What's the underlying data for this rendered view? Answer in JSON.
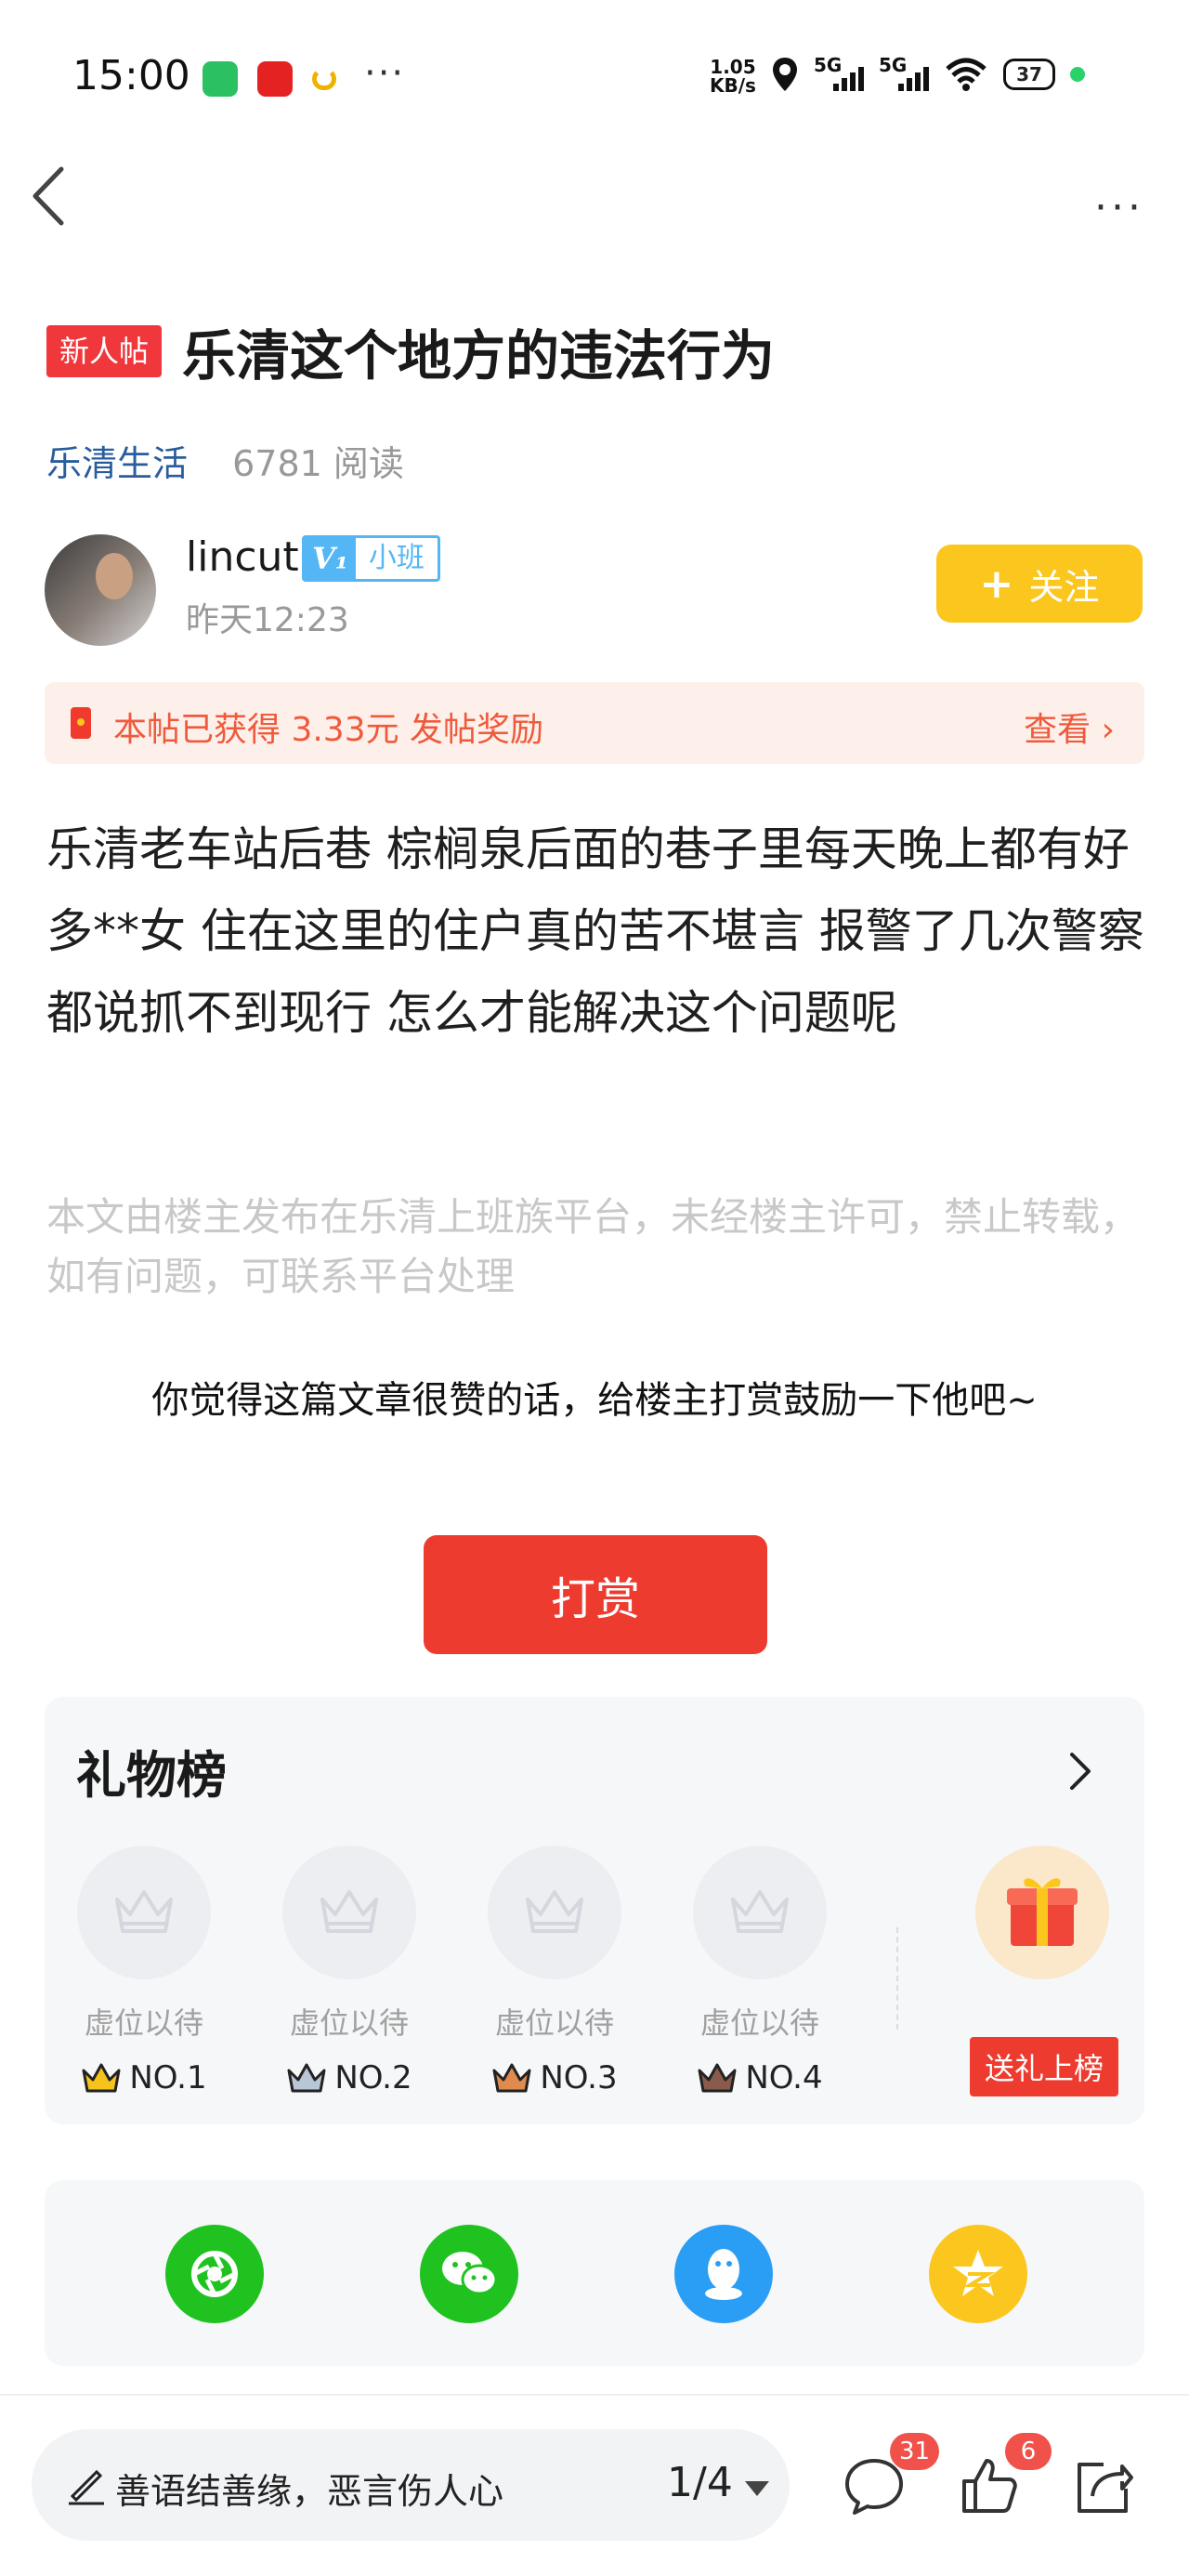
{
  "status_bar": {
    "time": "15:00",
    "more": "···",
    "net_speed_value": "1.05",
    "net_speed_unit": "KB/s",
    "signal1": "5G",
    "signal2": "5G",
    "battery": "37"
  },
  "nav": {
    "more": "···"
  },
  "post": {
    "badge": "新人帖",
    "title": "乐清这个地方的违法行为",
    "forum": "乐清生活",
    "reads": "6781 阅读",
    "author": {
      "name": "lincut",
      "level_badge": "V₁",
      "level_title": "小班",
      "time": "昨天12:23"
    },
    "follow_label": "关注",
    "reward_banner": {
      "text": "本帖已获得 3.33元 发帖奖励",
      "view": "查看 ›"
    },
    "content": "乐清老车站后巷 棕榈泉后面的巷子里每天晚上都有好多**女 住在这里的住户真的苦不堪言 报警了几次警察都说抓不到现行 怎么才能解决这个问题呢",
    "disclaimer": "本文由楼主发布在乐清上班族平台，未经楼主许可，禁止转载，如有问题，可联系平台处理",
    "tip_text": "你觉得这篇文章很赞的话，给楼主打赏鼓励一下他吧~",
    "tip_button": "打赏"
  },
  "gift_board": {
    "title": "礼物榜",
    "slots": [
      {
        "label": "虚位以待",
        "rank": "NO.1",
        "crown_color": "#f6c21c"
      },
      {
        "label": "虚位以待",
        "rank": "NO.2",
        "crown_color": "#b8c6d6"
      },
      {
        "label": "虚位以待",
        "rank": "NO.3",
        "crown_color": "#e08a4e"
      },
      {
        "label": "虚位以待",
        "rank": "NO.4",
        "crown_color": "#8a5a4a"
      }
    ],
    "gift_button": "送礼上榜"
  },
  "share": [
    {
      "icon": "moments-icon",
      "color": "#1fc21f"
    },
    {
      "icon": "wechat-icon",
      "color": "#1fc21f"
    },
    {
      "icon": "qq-icon",
      "color": "#2a9df4"
    },
    {
      "icon": "qzone-icon",
      "color": "#fbc61e"
    }
  ],
  "bottom_bar": {
    "comment_placeholder": "善语结善缘，恶言伤人心",
    "page_indicator": "1/4",
    "comment_count": "31",
    "like_count": "6"
  }
}
